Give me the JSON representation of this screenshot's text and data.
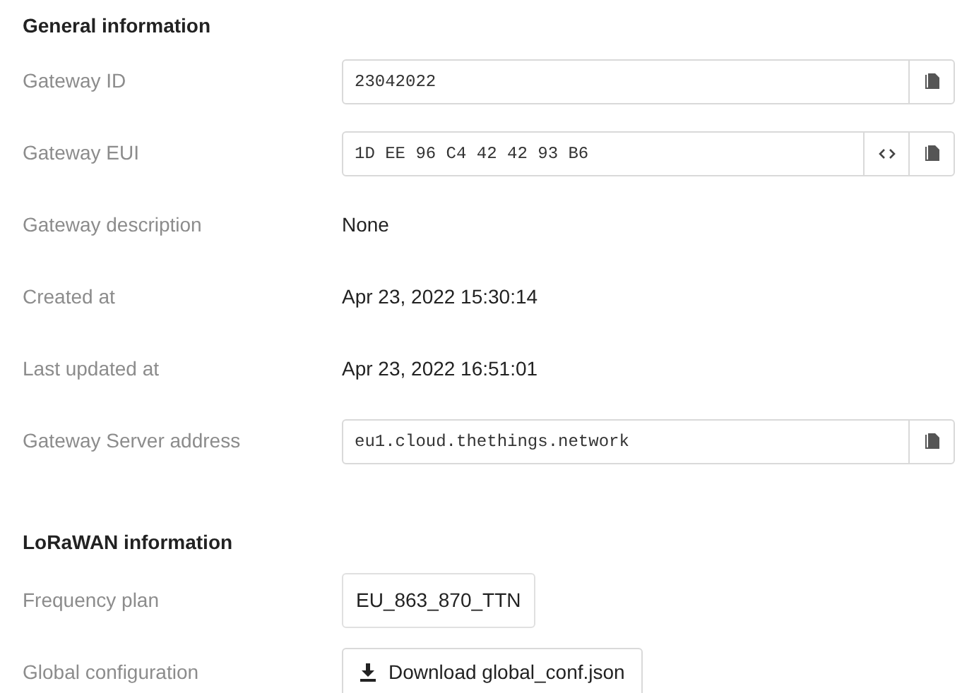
{
  "sections": [
    {
      "title": "General information",
      "rows": [
        {
          "label": "Gateway ID",
          "kind": "field",
          "value": "23042022",
          "buttons": [
            {
              "kind": "copy"
            }
          ]
        },
        {
          "label": "Gateway EUI",
          "kind": "field",
          "value": "1D EE 96 C4 42 42 93 B6",
          "buttons": [
            {
              "kind": "toggle"
            },
            {
              "kind": "copy"
            }
          ]
        },
        {
          "label": "Gateway description",
          "kind": "text",
          "value": "None"
        },
        {
          "label": "Created at",
          "kind": "text",
          "value": "Apr 23, 2022 15:30:14"
        },
        {
          "label": "Last updated at",
          "kind": "text",
          "value": "Apr 23, 2022 16:51:01"
        },
        {
          "label": "Gateway Server address",
          "kind": "field",
          "value": "eu1.cloud.thethings.network",
          "buttons": [
            {
              "kind": "copy"
            }
          ]
        }
      ]
    },
    {
      "title": "LoRaWAN information",
      "rows": [
        {
          "label": "Frequency plan",
          "kind": "tag",
          "value": "EU_863_870_TTN"
        },
        {
          "label": "Global configuration",
          "kind": "download",
          "value": "Download global_conf.json"
        }
      ]
    }
  ]
}
